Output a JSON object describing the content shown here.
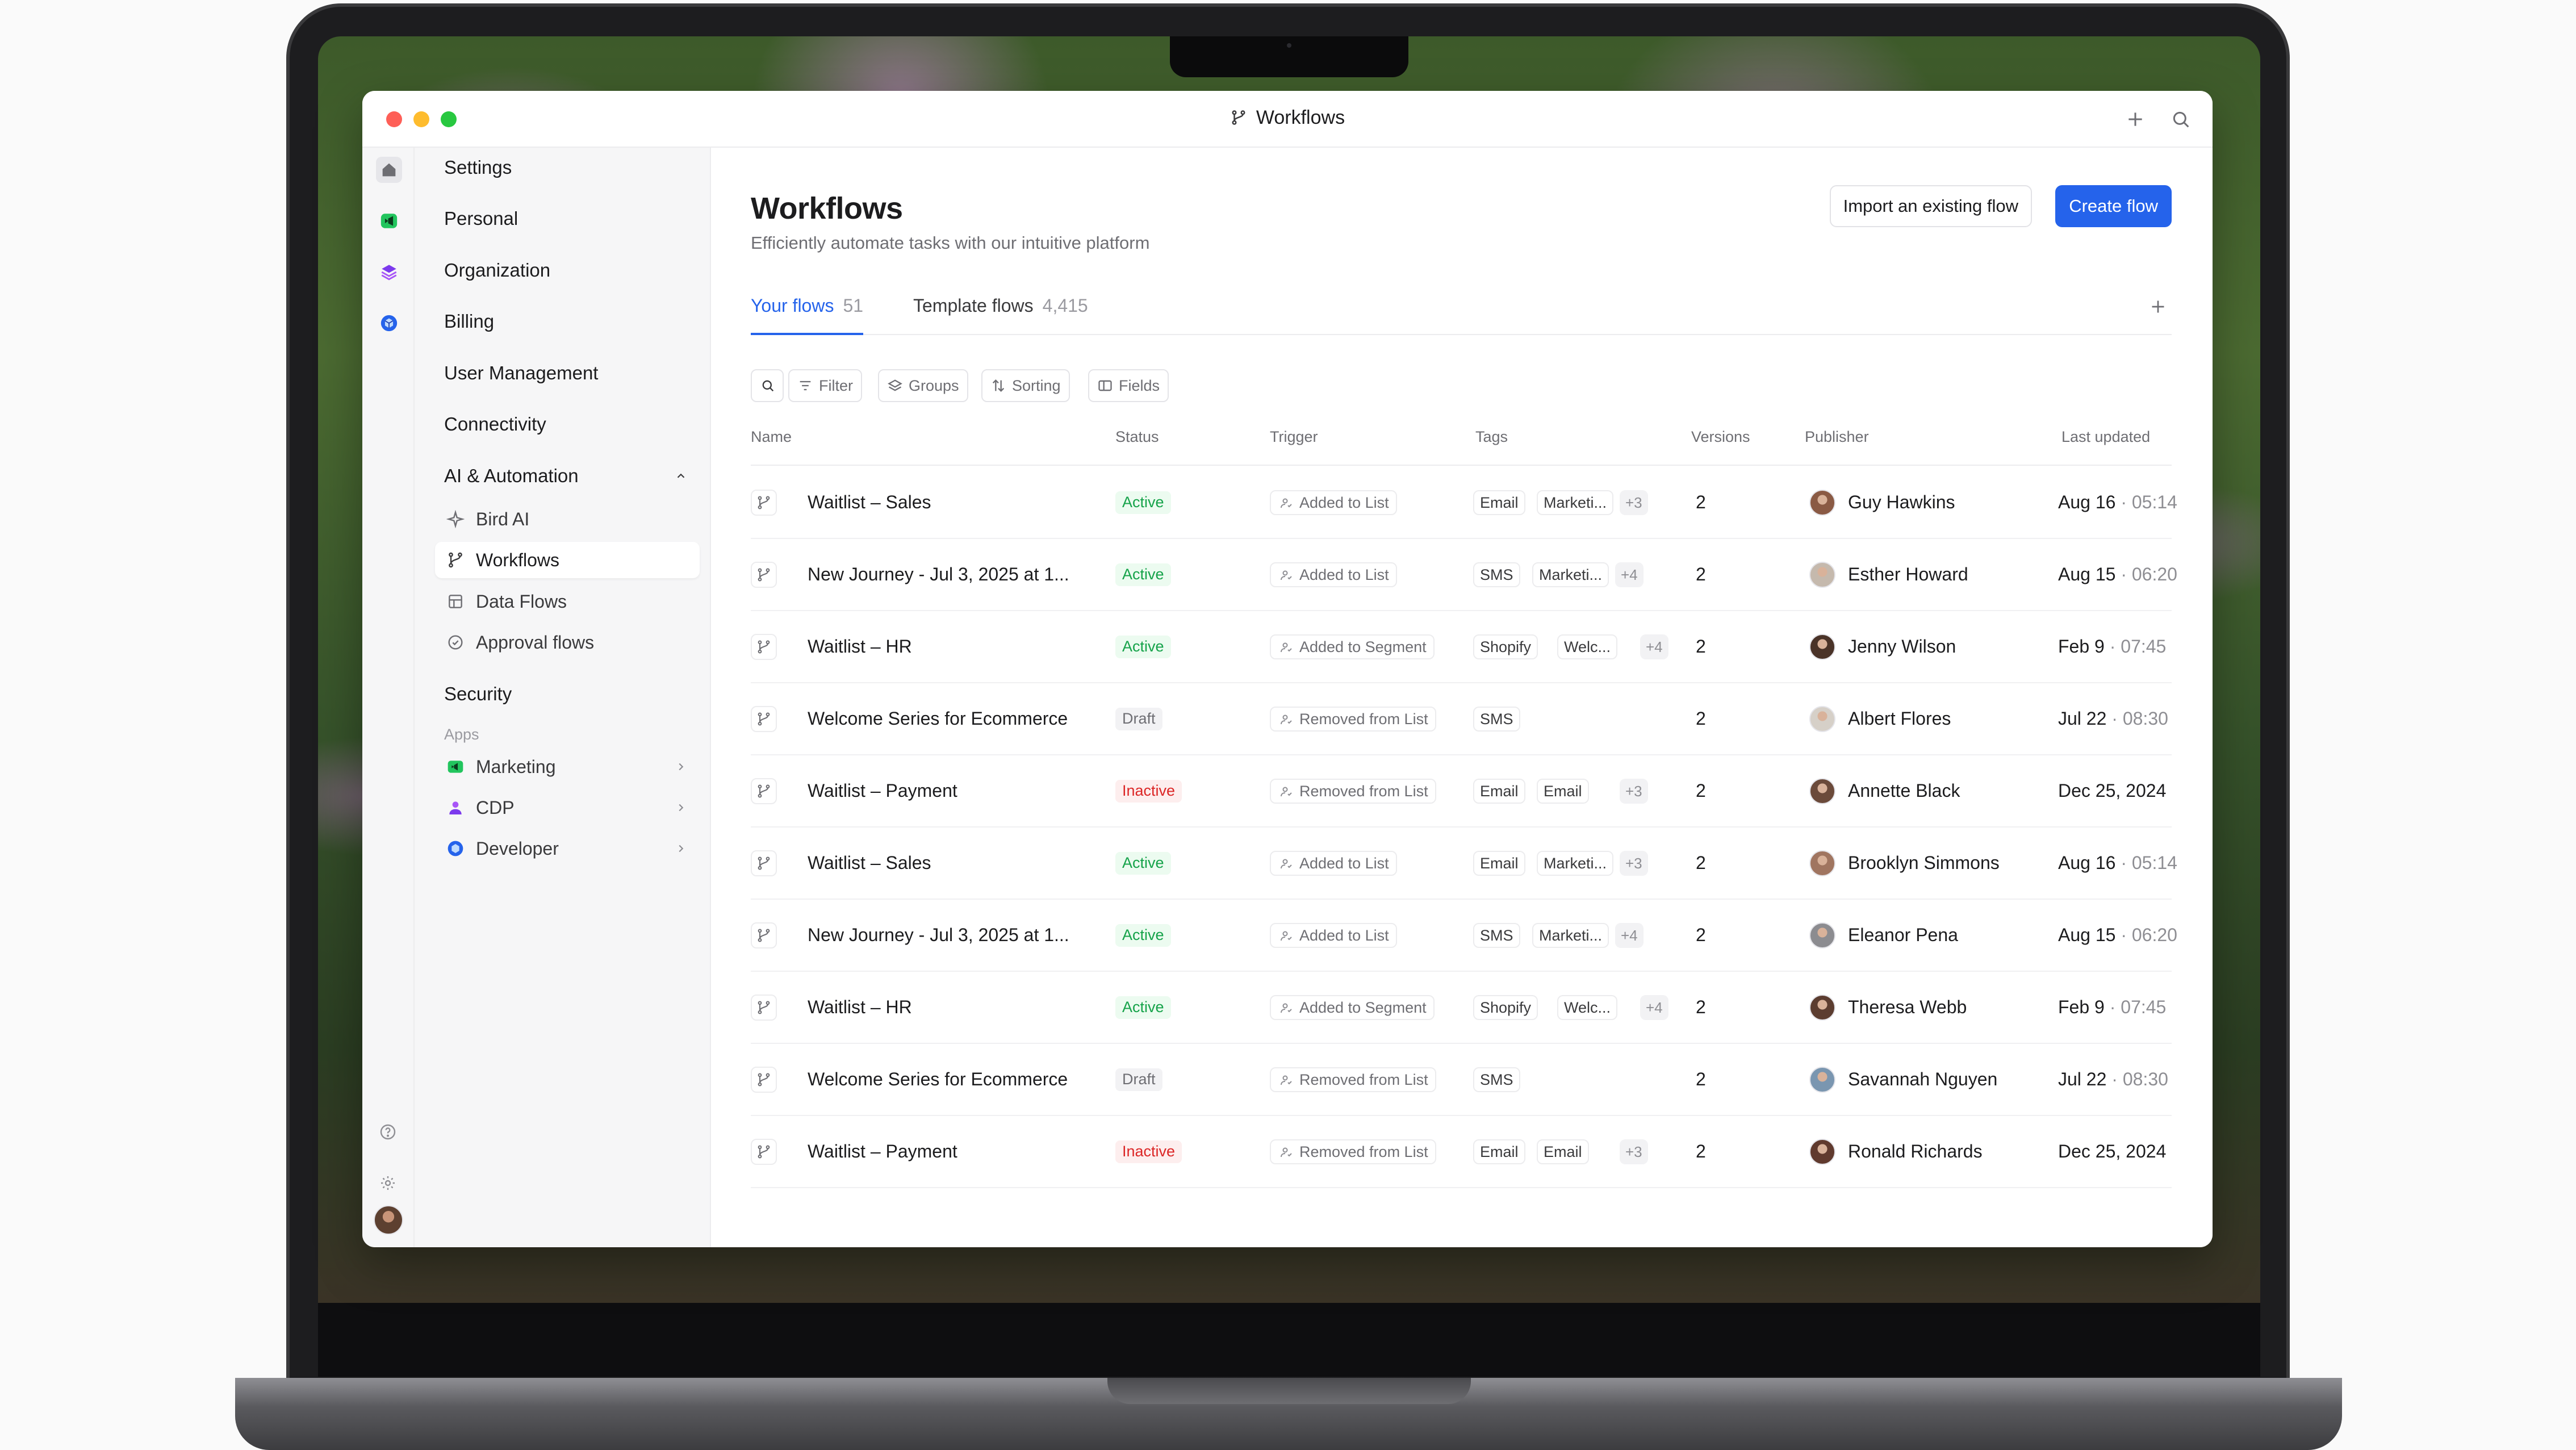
{
  "window": {
    "title": "Workflows"
  },
  "sidebar": {
    "items": [
      {
        "label": "Settings"
      },
      {
        "label": "Personal"
      },
      {
        "label": "Organization"
      },
      {
        "label": "Billing"
      },
      {
        "label": "User Management"
      },
      {
        "label": "Connectivity"
      },
      {
        "label": "AI & Automation"
      }
    ],
    "ai_sub": [
      {
        "label": "Bird AI"
      },
      {
        "label": "Workflows"
      },
      {
        "label": "Data Flows"
      },
      {
        "label": "Approval flows"
      }
    ],
    "security": "Security",
    "apps_heading": "Apps",
    "apps": [
      {
        "label": "Marketing"
      },
      {
        "label": "CDP"
      },
      {
        "label": "Developer"
      }
    ]
  },
  "main": {
    "title": "Workflows",
    "subtitle": "Efficiently automate tasks with our intuitive platform",
    "import_label": "Import an existing flow",
    "create_label": "Create flow",
    "tabs": [
      {
        "label": "Your flows",
        "count": "51"
      },
      {
        "label": "Template flows",
        "count": "4,415"
      }
    ],
    "toolbar": {
      "filter": "Filter",
      "groups": "Groups",
      "sorting": "Sorting",
      "fields": "Fields"
    }
  },
  "table": {
    "headers": {
      "name": "Name",
      "status": "Status",
      "trigger": "Trigger",
      "tags": "Tags",
      "versions": "Versions",
      "publisher": "Publisher",
      "updated": "Last updated"
    },
    "rows": [
      {
        "name": "Waitlist – Sales",
        "status": "Active",
        "trigger": "Added to List",
        "tags": [
          "Email",
          "Marketi..."
        ],
        "more": "+3",
        "versions": "2",
        "publisher": "Guy Hawkins",
        "date": "Aug 16",
        "time": "05:14"
      },
      {
        "name": "New Journey - Jul 3, 2025 at 1...",
        "status": "Active",
        "trigger": "Added to List",
        "tags": [
          "SMS",
          "Marketi..."
        ],
        "more": "+4",
        "versions": "2",
        "publisher": "Esther Howard",
        "date": "Aug 15",
        "time": "06:20"
      },
      {
        "name": "Waitlist – HR",
        "status": "Active",
        "trigger": "Added to Segment",
        "tags": [
          "Shopify",
          "Welc..."
        ],
        "more": "+4",
        "versions": "2",
        "publisher": "Jenny Wilson",
        "date": "Feb 9",
        "time": "07:45"
      },
      {
        "name": "Welcome Series for Ecommerce",
        "status": "Draft",
        "trigger": "Removed from List",
        "tags": [
          "SMS"
        ],
        "more": "",
        "versions": "2",
        "publisher": "Albert Flores",
        "date": "Jul 22",
        "time": "08:30"
      },
      {
        "name": "Waitlist – Payment",
        "status": "Inactive",
        "trigger": "Removed from List",
        "tags": [
          "Email",
          "Email"
        ],
        "more": "+3",
        "versions": "2",
        "publisher": "Annette Black",
        "date": "Dec 25, 2024",
        "time": ""
      },
      {
        "name": "Waitlist – Sales",
        "status": "Active",
        "trigger": "Added to List",
        "tags": [
          "Email",
          "Marketi..."
        ],
        "more": "+3",
        "versions": "2",
        "publisher": "Brooklyn Simmons",
        "date": "Aug 16",
        "time": "05:14"
      },
      {
        "name": "New Journey - Jul 3, 2025 at 1...",
        "status": "Active",
        "trigger": "Added to List",
        "tags": [
          "SMS",
          "Marketi..."
        ],
        "more": "+4",
        "versions": "2",
        "publisher": "Eleanor Pena",
        "date": "Aug 15",
        "time": "06:20"
      },
      {
        "name": "Waitlist – HR",
        "status": "Active",
        "trigger": "Added to Segment",
        "tags": [
          "Shopify",
          "Welc..."
        ],
        "more": "+4",
        "versions": "2",
        "publisher": "Theresa Webb",
        "date": "Feb 9",
        "time": "07:45"
      },
      {
        "name": "Welcome Series for Ecommerce",
        "status": "Draft",
        "trigger": "Removed from List",
        "tags": [
          "SMS"
        ],
        "more": "",
        "versions": "2",
        "publisher": "Savannah Nguyen",
        "date": "Jul 22",
        "time": "08:30"
      },
      {
        "name": "Waitlist – Payment",
        "status": "Inactive",
        "trigger": "Removed from List",
        "tags": [
          "Email",
          "Email"
        ],
        "more": "+3",
        "versions": "2",
        "publisher": "Ronald Richards",
        "date": "Dec 25, 2024",
        "time": ""
      }
    ]
  },
  "colors": {
    "accent": "#2563eb",
    "active": "#16a34a",
    "inactive": "#dc2626"
  }
}
